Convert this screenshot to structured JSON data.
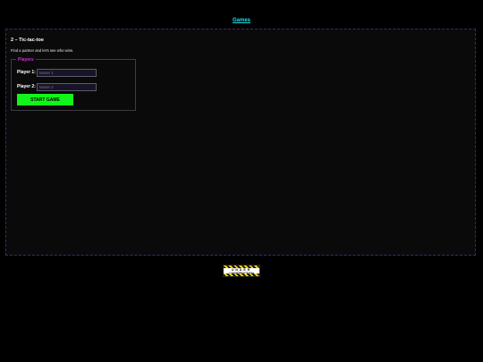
{
  "nav": {
    "games_link": "Games"
  },
  "page": {
    "title": "2 – Tic-tac-toe",
    "subtitle": "Find a partner and let's see who wins."
  },
  "players_form": {
    "legend": "Players",
    "player1_label": "Player 1:",
    "player1_placeholder": "Name 1",
    "player2_label": "Player 2:",
    "player2_placeholder": "Name 2",
    "start_button": "START GAME"
  },
  "badge": {
    "word1": "UNDER",
    "word2": "CONSTRUCTION"
  },
  "colors": {
    "link": "#19e0e8",
    "legend": "#d22ec8",
    "start_button": "#12f51b",
    "background": "#000000"
  }
}
